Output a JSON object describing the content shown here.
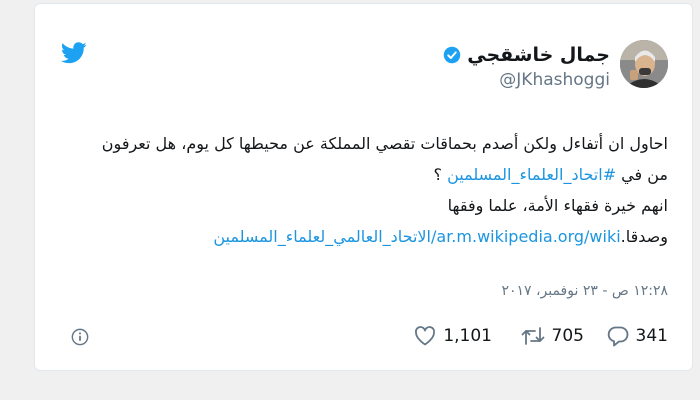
{
  "tweet": {
    "display_name": "جمال خاشقجي",
    "handle": "@JKhashoggi",
    "body": {
      "line1": "احاول ان أتفاءل ولكن أصدم بحماقات تقصي المملكة عن محيطها كل يوم، هل تعرفون",
      "line2_prefix": "من في ",
      "hashtag": "#اتحاد_العلماء_المسلمين",
      "line2_suffix": " ؟",
      "line3": "انهم خيرة فقهاء الأمة، علما وفقها",
      "line4_prefix": "وصدقا.",
      "link": "ar.m.wikipedia.org/wiki/الاتحاد_العالمي_لعلماء_المسلمين"
    },
    "timestamp": "١٢:٢٨ ص - ٢٣ نوفمبر، ٢٠١٧",
    "stats": {
      "replies": "341",
      "retweets": "705",
      "likes": "1,101"
    }
  },
  "icons": {
    "brand": "twitter-bird-icon",
    "verified": "verified-badge-icon",
    "reply": "reply-icon",
    "retweet": "retweet-icon",
    "like": "heart-icon",
    "info": "info-icon"
  },
  "colors": {
    "brand": "#1da1f2",
    "link": "#1b95e0",
    "text": "#14171a",
    "muted": "#657786"
  }
}
